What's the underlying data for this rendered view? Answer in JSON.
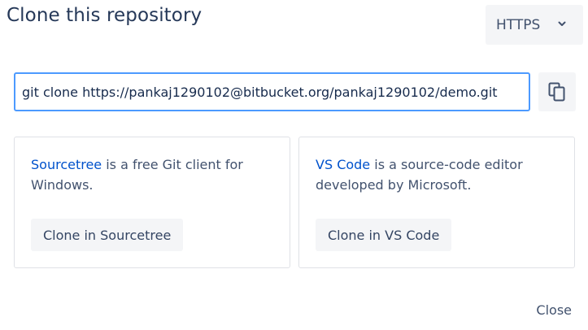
{
  "dialog": {
    "title": "Clone this repository",
    "protocol": {
      "selected": "HTTPS",
      "icon": "chevron-down-icon"
    },
    "clone_command": "git clone https://pankaj1290102@bitbucket.org/pankaj1290102/demo.git",
    "copy_icon": "copy-icon",
    "accent_color": "#4c9aff",
    "link_color": "#0052cc",
    "cards": [
      {
        "link": "Sourcetree",
        "description": " is a free Git client for Windows.",
        "button": "Clone in Sourcetree"
      },
      {
        "link": "VS Code",
        "description": " is a source-code editor developed by Microsoft.",
        "button": "Clone in VS Code"
      }
    ],
    "close_label": "Close"
  }
}
